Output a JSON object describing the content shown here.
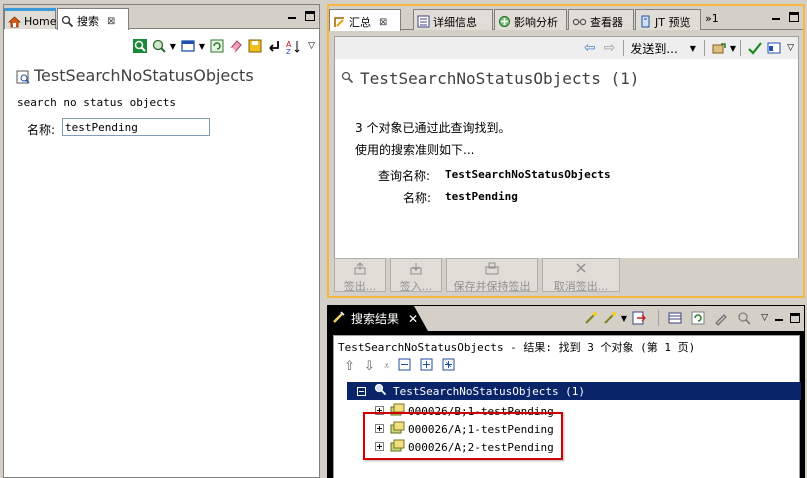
{
  "left": {
    "tabs": [
      {
        "label": "Home"
      },
      {
        "label": "搜索"
      }
    ],
    "query_title": "TestSearchNoStatusObjects",
    "description": "search no status objects",
    "field_label": "名称:",
    "field_value": "testPending"
  },
  "summary": {
    "tabs": [
      {
        "label": "汇总"
      },
      {
        "label": "详细信息"
      },
      {
        "label": "影响分析"
      },
      {
        "label": "查看器"
      },
      {
        "label": "JT 预览"
      },
      {
        "label": "»1"
      }
    ],
    "send_to": "发送到...",
    "header": "TestSearchNoStatusObjects (1)",
    "line1": "3 个对象已通过此查询找到。",
    "line2": "使用的搜索准则如下...",
    "criteria": [
      {
        "label": "查询名称:",
        "value": "TestSearchNoStatusObjects"
      },
      {
        "label": "名称:",
        "value": "testPending"
      }
    ],
    "buttons": [
      {
        "label": "签出..."
      },
      {
        "label": "签入..."
      },
      {
        "label": "保存并保持签出"
      },
      {
        "label": "取消签出..."
      }
    ]
  },
  "results": {
    "tab_label": "搜索结果",
    "status": "TestSearchNoStatusObjects - 结果: 找到 3 个对象 (第 1 页)",
    "root": "TestSearchNoStatusObjects (1)",
    "items": [
      {
        "label": "000026/B;1-testPending"
      },
      {
        "label": "000026/A;1-testPending"
      },
      {
        "label": "000026/A;2-testPending"
      }
    ]
  },
  "colors": {
    "accent_orange": "#f5b942",
    "selection_navy": "#0a246a",
    "highlight_red": "#d00000"
  }
}
